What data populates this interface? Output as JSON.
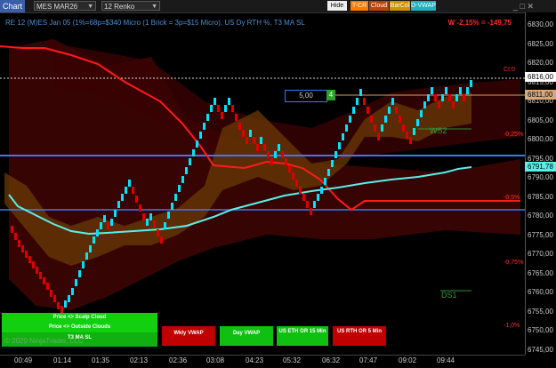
{
  "toolbar": {
    "chart_label": "Chart",
    "instrument": "MES MAR26",
    "bar_type": "12 Renko",
    "buttons": {
      "hide": "Hide",
      "tcr": "T-CR",
      "cloud": "Cloud",
      "barcol": "BarCol",
      "dvwap": "D-VWAP"
    }
  },
  "header": {
    "title": "RE 12 (M)ES Jan 05 (1%=68p=$340 Micro (1 Brick = 3p=$15 Micro), US Dy RTH %, T3 MA SL",
    "pnl": "W -2,15% = -149,75"
  },
  "price_axis": {
    "ticks": [
      "6830,00",
      "6825,00",
      "6820,00",
      "6815,00",
      "6810,00",
      "6805,00",
      "6800,00",
      "6795,00",
      "6790,00",
      "6785,00",
      "6780,00",
      "6775,00",
      "6770,00",
      "6765,00",
      "6760,00",
      "6755,00",
      "6750,00",
      "6745,00"
    ],
    "labels": {
      "last": "6816,00",
      "level": "6811,00",
      "ma": "6791,78"
    }
  },
  "time_axis": [
    "00:49",
    "01:14",
    "01:35",
    "02:13",
    "02:36",
    "03:08",
    "04:23",
    "05:32",
    "06:32",
    "07:47",
    "09:02",
    "09:44"
  ],
  "overlay": {
    "ci_label": "CI:0",
    "pct_labels": [
      "-0,25%",
      "-0,5%",
      "-0,75%",
      "-1,0%"
    ],
    "ws2": "WS2",
    "ds1": "DS1",
    "box_value": "5,00",
    "box_count": "4",
    "watermark": "© 2020 NinjaTrader, LLC"
  },
  "panel_buttons": {
    "scalp_cloud": "Price <> Scalp Cloud",
    "outside_clouds": "Price <> Outside Clouds",
    "t3ma": "T3 MA SL",
    "wkly_vwap": "Wkly VWAP",
    "day_vwap": "Day VWAP",
    "eth": "US ETH OR 15 Min",
    "rth": "US RTH OR 5 Min"
  },
  "colors": {
    "up": "#00e5ff",
    "down": "#e00000",
    "ma": "#5af0e8",
    "accent_blue": "#3a78ff"
  }
}
